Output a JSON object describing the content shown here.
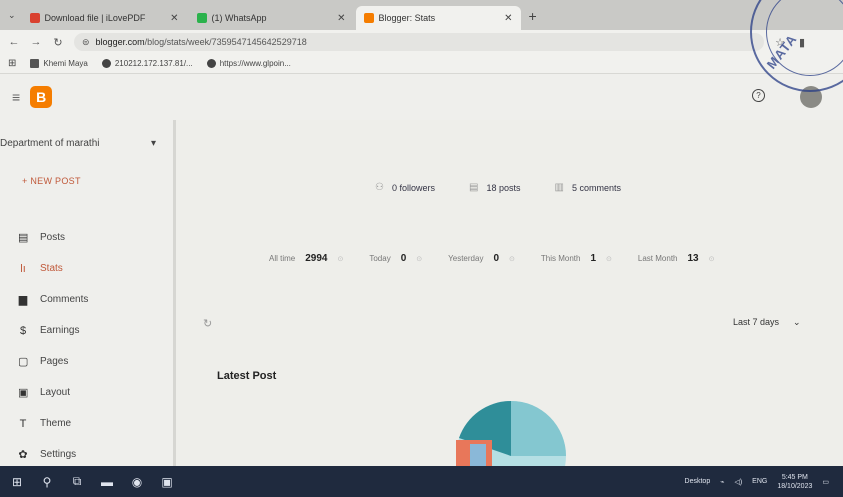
{
  "browser": {
    "tabs": [
      {
        "title": "Download file | iLovePDF",
        "active": false,
        "favicon_color": "#d9412f"
      },
      {
        "title": "(1) WhatsApp",
        "active": false,
        "favicon_color": "#2bb24c"
      },
      {
        "title": "Blogger: Stats",
        "active": true,
        "favicon_color": "#f57d00"
      }
    ],
    "new_tab": "+",
    "url_domain": "blogger.com",
    "url_path": "/blog/stats/week/7359547145642529718",
    "bookmarks": [
      "Khemi Maya",
      "210212.172.137.81/...",
      "https://www.glpoin..."
    ]
  },
  "sidebar": {
    "blog_name": "Department of marathi",
    "new_post": "+ NEW POST",
    "items": [
      {
        "label": "Posts",
        "icon": "posts-icon",
        "glyph": "▤",
        "active": false
      },
      {
        "label": "Stats",
        "icon": "stats-icon",
        "glyph": "▂▆",
        "active": true
      },
      {
        "label": "Comments",
        "icon": "comments-icon",
        "glyph": "▆",
        "active": false
      },
      {
        "label": "Earnings",
        "icon": "earnings-icon",
        "glyph": "$",
        "active": false
      },
      {
        "label": "Pages",
        "icon": "pages-icon",
        "glyph": "▢",
        "active": false
      },
      {
        "label": "Layout",
        "icon": "layout-icon",
        "glyph": "▣",
        "active": false
      },
      {
        "label": "Theme",
        "icon": "theme-icon",
        "glyph": "T",
        "active": false
      },
      {
        "label": "Settings",
        "icon": "gear-icon",
        "glyph": "✿",
        "active": false
      }
    ]
  },
  "summary": {
    "followers": "0 followers",
    "posts": "18 posts",
    "comments": "5 comments"
  },
  "counts": [
    {
      "label": "All time",
      "value": "2994"
    },
    {
      "label": "Today",
      "value": "0"
    },
    {
      "label": "Yesterday",
      "value": "0"
    },
    {
      "label": "This Month",
      "value": "1"
    },
    {
      "label": "Last Month",
      "value": "13"
    }
  ],
  "range": {
    "label": "Last 7 days",
    "chevron": "⌄"
  },
  "latest_post": {
    "title": "Latest Post"
  },
  "pie_colors": [
    "#2f8e99",
    "#84c7d0",
    "#e8775a",
    "#b5dfe4"
  ],
  "taskbar": {
    "clock_time": "5:45 PM",
    "clock_date": "18/10/2023",
    "lang": "ENG"
  },
  "stamp": {
    "text": "MATA"
  }
}
